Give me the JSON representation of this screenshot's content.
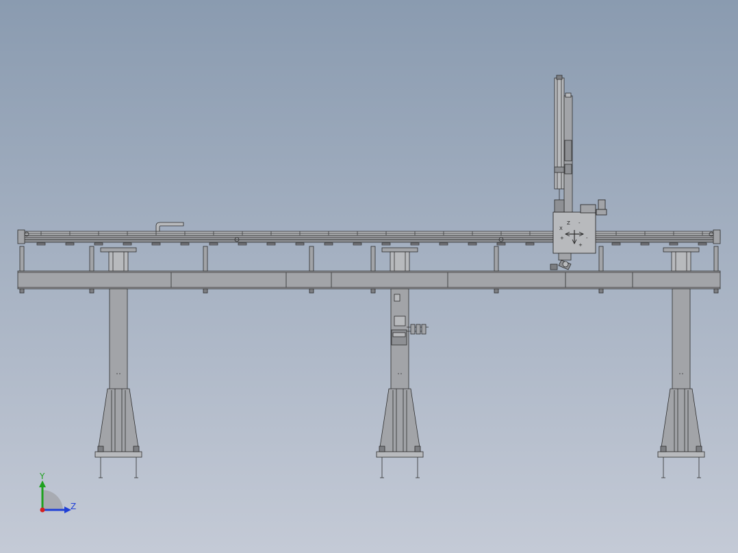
{
  "viewport": {
    "background_top": "#8a9bb0",
    "background_bottom": "#c4cad6"
  },
  "colors": {
    "steel_fill": "#a2a4a8",
    "steel_dark": "#7c7e82",
    "steel_light": "#b8babd",
    "line": "#2b2b2b",
    "axis_y": "#1fa11f",
    "axis_z": "#1f3fd6",
    "axis_origin": "#d42020",
    "axis_quadrant": "#a8abb2"
  },
  "triad": {
    "y_label": "Y",
    "z_label": "Z",
    "icon": "coordinate-triad-icon"
  },
  "carriage_markings": {
    "top_label": "Z",
    "left_label": "X",
    "plus": "+",
    "minus": "-"
  }
}
